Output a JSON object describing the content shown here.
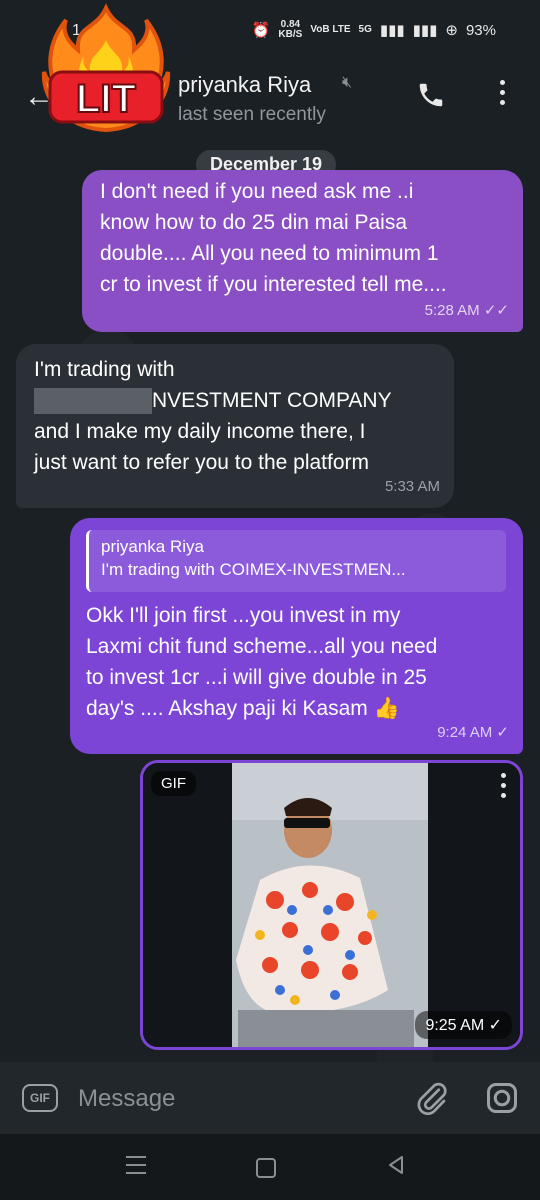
{
  "status_bar": {
    "time": "1",
    "net_speed": "0.84",
    "net_unit": "KB/S",
    "volte": "VoB LTE",
    "network": "5G",
    "battery": "93%"
  },
  "header": {
    "contact_name": "priyanka Riya",
    "last_seen": "last seen recently",
    "sticker_text": "LIT"
  },
  "date_divider": "December 19",
  "messages": [
    {
      "direction": "outgoing",
      "lines": [
        "I don't need if you need ask me ..i",
        "know how to do 25 din mai Paisa",
        "double.... All you need to minimum 1",
        "cr to invest if you interested tell me...."
      ],
      "time": "5:28 AM",
      "status": "read"
    },
    {
      "direction": "incoming",
      "lines": [
        "I'm trading with",
        "NVESTMENT COMPANY",
        "and I make my daily income there, I",
        "just want to refer you to the platform"
      ],
      "time": "5:33 AM"
    },
    {
      "direction": "outgoing",
      "reply_to": {
        "name": "priyanka Riya",
        "text": "I'm trading with COIMEX-INVESTMEN..."
      },
      "lines": [
        "Okk I'll join first ...you invest in my",
        "Laxmi chit fund scheme...all you need",
        "to invest 1cr ...i will give double in 25",
        "day's .... Akshay paji ki Kasam 👍"
      ],
      "time": "9:24 AM",
      "status": "sent"
    },
    {
      "direction": "outgoing",
      "type": "gif",
      "badge": "GIF",
      "time": "9:25 AM",
      "status": "sent"
    }
  ],
  "input": {
    "gif_label": "GIF",
    "placeholder": "Message"
  },
  "colors": {
    "outgoing_bubble": "#8a4fc4",
    "outgoing_bubble_2": "#7c45d6",
    "incoming_bubble": "#2b3036",
    "background": "#1b2025"
  }
}
